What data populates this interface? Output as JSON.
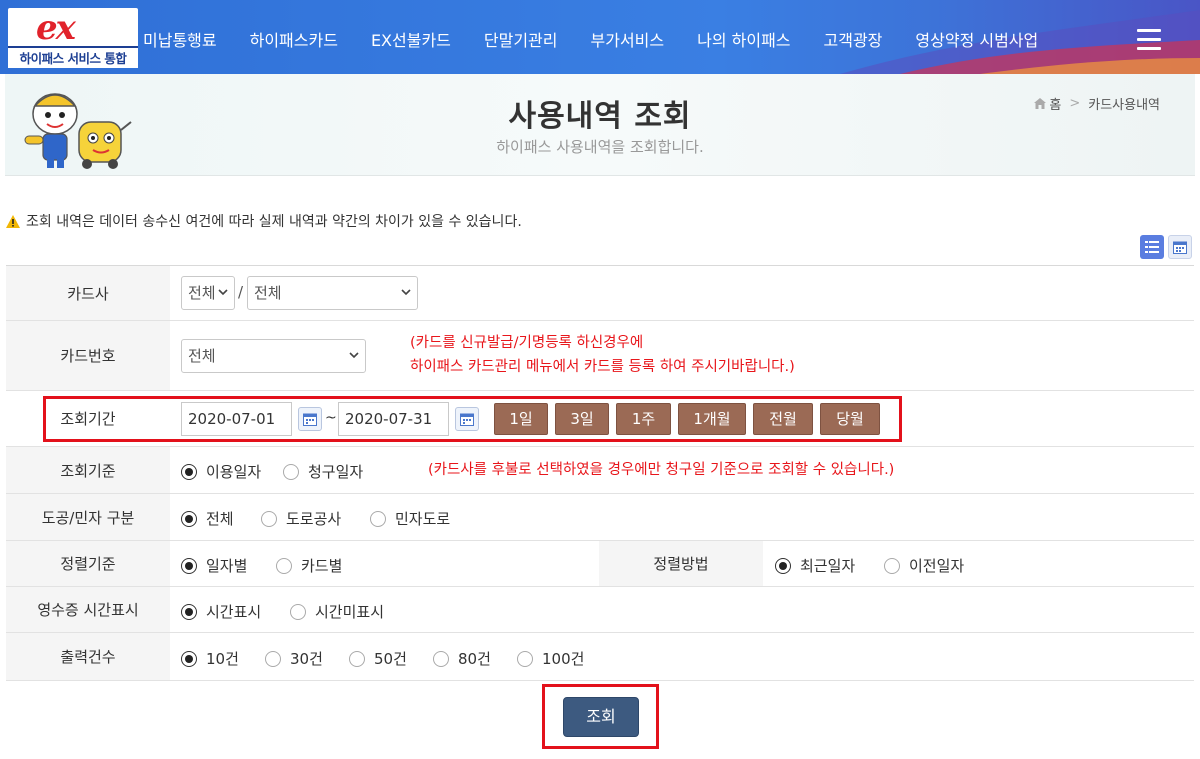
{
  "header": {
    "logo_text": "하이패스 서비스 통합",
    "logo_mark": "ex",
    "menu": [
      "미납통행료",
      "하이패스카드",
      "EX선불카드",
      "단말기관리",
      "부가서비스",
      "나의 하이패스",
      "고객광장",
      "영상약정 시범사업"
    ]
  },
  "banner": {
    "title": "사용내역 조회",
    "subtitle": "하이패스 사용내역을 조회합니다.",
    "breadcrumb": [
      "홈",
      "카드사용내역"
    ]
  },
  "notice": "조회 내역은 데이터 송수신 여건에 따라 실제 내역과 약간의 차이가 있을 수 있습니다.",
  "form": {
    "card_company": {
      "label": "카드사",
      "select1": "전체",
      "select2": "전체"
    },
    "card_number": {
      "label": "카드번호",
      "select": "전체",
      "note_line1": "(카드를 신규발급/기명등록 하신경우에",
      "note_line2": "하이패스 카드관리 메뉴에서 카드를 등록 하여 주시기바랍니다.)"
    },
    "period": {
      "label": "조회기간",
      "start": "2020-07-01",
      "end": "2020-07-31",
      "tilde": "~",
      "buttons": [
        "1일",
        "3일",
        "1주",
        "1개월",
        "전월",
        "당월"
      ]
    },
    "basis": {
      "label": "조회기준",
      "options": [
        "이용일자",
        "청구일자"
      ],
      "selected": "이용일자",
      "note": "(카드사를 후불로 선택하였을 경우에만 청구일 기준으로 조회할 수 있습니다.)"
    },
    "road_type": {
      "label": "도공/민자 구분",
      "options": [
        "전체",
        "도로공사",
        "민자도로"
      ],
      "selected": "전체"
    },
    "sort_basis": {
      "label": "정렬기준",
      "options": [
        "일자별",
        "카드별"
      ],
      "selected": "일자별"
    },
    "sort_method": {
      "label": "정렬방법",
      "options": [
        "최근일자",
        "이전일자"
      ],
      "selected": "최근일자"
    },
    "receipt_time": {
      "label": "영수증 시간표시",
      "options": [
        "시간표시",
        "시간미표시"
      ],
      "selected": "시간표시"
    },
    "output_count": {
      "label": "출력건수",
      "options": [
        "10건",
        "30건",
        "50건",
        "80건",
        "100건"
      ],
      "selected": "10건"
    }
  },
  "submit_label": "조회",
  "colors": {
    "nav_blue": "#3a7fe3",
    "period_button": "#9b6a55",
    "submit": "#3d5a80",
    "note_red": "#e8161b",
    "highlight_red": "#e3111b"
  }
}
